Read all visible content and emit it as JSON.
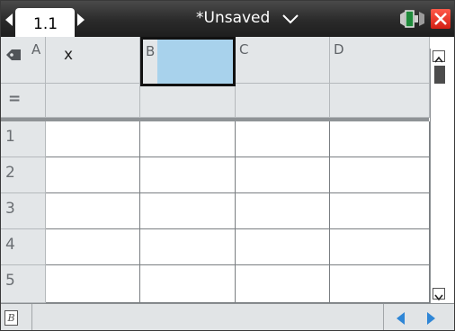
{
  "titlebar": {
    "page_tab": "1.1",
    "doc_title": "*Unsaved",
    "title_menu_icon": "chevron-down-icon",
    "battery_icon": "battery-icon",
    "close_icon": "close-icon",
    "close_color": "#e0281b"
  },
  "spreadsheet": {
    "columns": [
      {
        "letter": "A",
        "name": "x"
      },
      {
        "letter": "B",
        "name": ""
      },
      {
        "letter": "C",
        "name": ""
      },
      {
        "letter": "D",
        "name": ""
      }
    ],
    "formula_row_symbol": "=",
    "rows": [
      "1",
      "2",
      "3",
      "4",
      "5"
    ],
    "selected_cell": "B",
    "selection_color": "#a8d2ec",
    "tag_icon": "tag-icon"
  },
  "entrybar": {
    "value": "",
    "entry_icon": "italic-b-icon",
    "entry_icon_text": "B",
    "prev_icon": "triangle-left-icon",
    "next_icon": "triangle-right-icon",
    "nav_color": "#2f86d6"
  }
}
